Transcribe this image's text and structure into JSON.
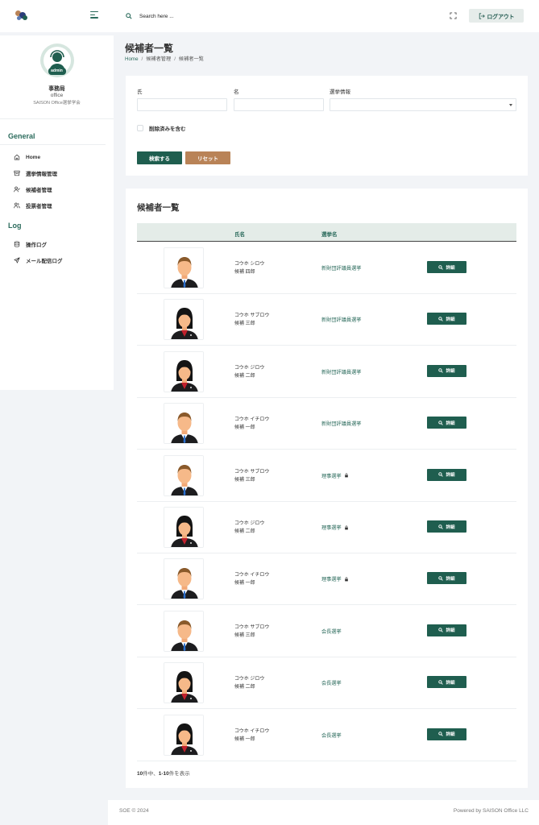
{
  "header": {
    "search_placeholder": "Search here ...",
    "logout_label": "ログアウト"
  },
  "sidebar": {
    "user": {
      "badge": "admin",
      "name": "事務局",
      "role": "office",
      "organization": "SAISON Office選挙学会"
    },
    "sections": {
      "general": "General",
      "log": "Log"
    },
    "general_items": [
      {
        "label": "Home",
        "icon": "home-icon"
      },
      {
        "label": "選挙情報管理",
        "icon": "archive-icon"
      },
      {
        "label": "候補者管理",
        "icon": "user-check-icon"
      },
      {
        "label": "投票者管理",
        "icon": "users-icon"
      }
    ],
    "log_items": [
      {
        "label": "操作ログ",
        "icon": "database-icon"
      },
      {
        "label": "メール配信ログ",
        "icon": "send-icon"
      }
    ]
  },
  "page": {
    "title": "候補者一覧",
    "breadcrumb": [
      "Home",
      "候補者管理",
      "候補者一覧"
    ]
  },
  "filter": {
    "last_name_label": "氏",
    "first_name_label": "名",
    "election_label": "選挙情報",
    "last_name_value": "",
    "first_name_value": "",
    "election_value": "",
    "include_deleted_label": "削除済みを含む",
    "include_deleted": false,
    "search_button": "検索する",
    "reset_button": "リセット"
  },
  "list": {
    "title": "候補者一覧",
    "columns": {
      "name": "氏名",
      "election": "選挙名"
    },
    "detail_label": "詳細",
    "rows": [
      {
        "kana": "コウホ シロウ",
        "name": "候補 四郎",
        "election": "新財団評議員選挙",
        "locked": false,
        "gender": "male"
      },
      {
        "kana": "コウホ サブロウ",
        "name": "候補 三郎",
        "election": "新財団評議員選挙",
        "locked": false,
        "gender": "female"
      },
      {
        "kana": "コウホ ジロウ",
        "name": "候補 二郎",
        "election": "新財団評議員選挙",
        "locked": false,
        "gender": "female"
      },
      {
        "kana": "コウホ イチロウ",
        "name": "候補 一郎",
        "election": "新財団評議員選挙",
        "locked": false,
        "gender": "male"
      },
      {
        "kana": "コウホ サブロウ",
        "name": "候補 三郎",
        "election": "理事選挙",
        "locked": true,
        "gender": "male"
      },
      {
        "kana": "コウホ ジロウ",
        "name": "候補 二郎",
        "election": "理事選挙",
        "locked": true,
        "gender": "female"
      },
      {
        "kana": "コウホ イチロウ",
        "name": "候補 一郎",
        "election": "理事選挙",
        "locked": true,
        "gender": "male"
      },
      {
        "kana": "コウホ サブロウ",
        "name": "候補 三郎",
        "election": "会長選挙",
        "locked": false,
        "gender": "male"
      },
      {
        "kana": "コウホ ジロウ",
        "name": "候補 二郎",
        "election": "会長選挙",
        "locked": false,
        "gender": "female"
      },
      {
        "kana": "コウホ イチロウ",
        "name": "候補 一郎",
        "election": "会長選挙",
        "locked": false,
        "gender": "female"
      }
    ],
    "pager_total": "10",
    "pager_range": "1-10",
    "pager_suffix_1": "件中、",
    "pager_suffix_2": "件を表示"
  },
  "footer": {
    "copyright": "SOE © 2024",
    "powered_by": "Powered by SAISON Office LLC"
  },
  "colors": {
    "primary": "#1f5e4f",
    "accent": "#b98357",
    "link": "#2b6b5c"
  }
}
